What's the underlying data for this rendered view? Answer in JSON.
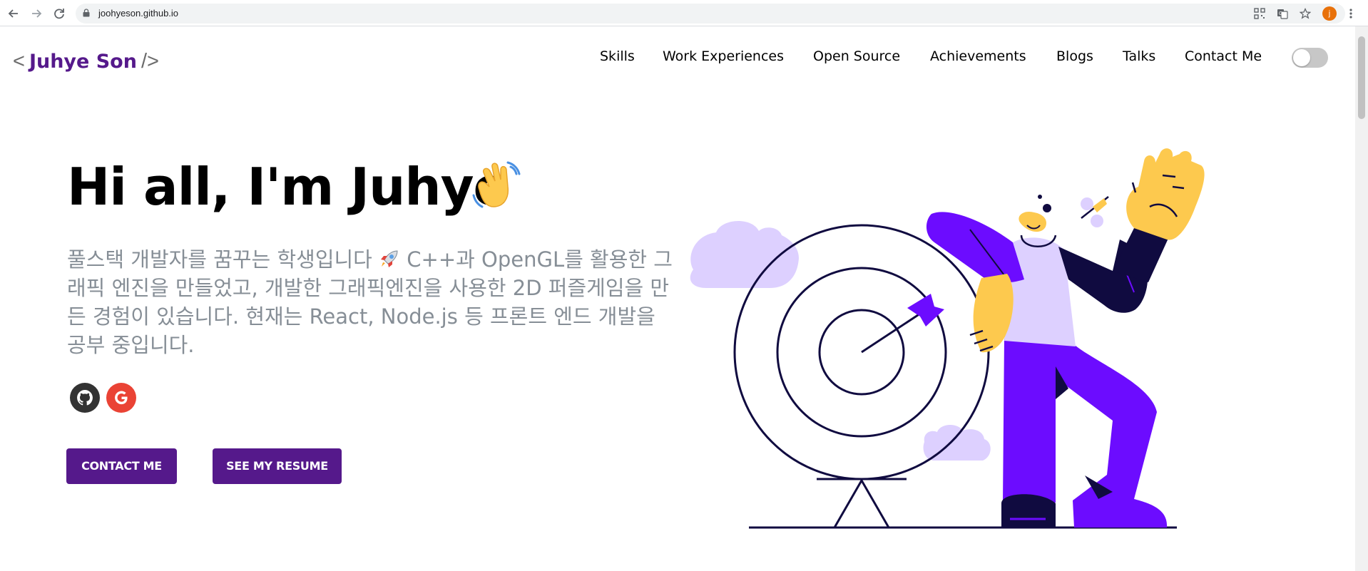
{
  "browser": {
    "url": "joohyeson.github.io",
    "profile_initial": "j",
    "icons": [
      "back-icon",
      "forward-icon",
      "reload-icon",
      "lock-icon",
      "qr-code-icon",
      "translate-icon",
      "star-icon",
      "menu-kebab-icon"
    ]
  },
  "header": {
    "logo_open": "<",
    "logo_name": "Juhye Son",
    "logo_close": "/>",
    "nav": [
      "Skills",
      "Work Experiences",
      "Open Source",
      "Achievements",
      "Blogs",
      "Talks",
      "Contact Me"
    ]
  },
  "hero": {
    "greeting": "Hi all, I'm Juhye",
    "subtitle_before_rocket": "풀스택 개발자를 꿈꾸는 학생입니다 ",
    "subtitle_after_rocket": " C++과 OpenGL를 활용한 그래픽 엔진을 만들었고, 개발한 그래픽엔진을 사용한 2D 퍼즐게임을 만든 경험이 있습니다. 현재는 React, Node.js 등 프론트 엔드 개발을 공부 중입니다.",
    "social": [
      "github",
      "google"
    ],
    "buttons": {
      "contact": "CONTACT ME",
      "resume": "SEE MY RESUME"
    }
  },
  "theme": {
    "accent": "#55198b",
    "subtitle_color": "#868e96",
    "illustration_purple": "#6c0cff",
    "illustration_lilac": "#ddd0ff",
    "illustration_yellow": "#fdc94e",
    "illustration_navy": "#100b40"
  }
}
